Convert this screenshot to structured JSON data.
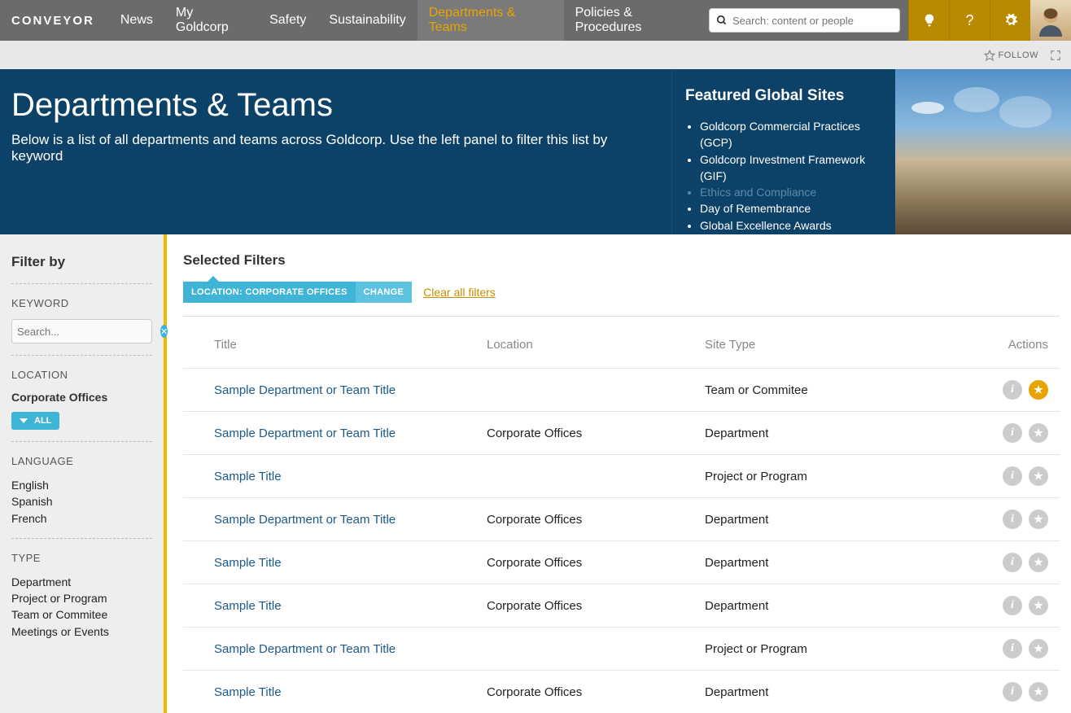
{
  "brand": "CONVEYOR",
  "nav": [
    {
      "label": "News",
      "active": false
    },
    {
      "label": "My Goldcorp",
      "active": false
    },
    {
      "label": "Safety",
      "active": false
    },
    {
      "label": "Sustainability",
      "active": false
    },
    {
      "label": "Departments & Teams",
      "active": true
    },
    {
      "label": "Policies & Procedures",
      "active": false
    }
  ],
  "search": {
    "placeholder": "Search: content or people"
  },
  "utilbar": {
    "follow": "FOLLOW"
  },
  "hero": {
    "title": "Departments & Teams",
    "subtitle": "Below is a list of all departments and teams across Goldcorp. Use the left panel to filter this list by keyword"
  },
  "featured": {
    "heading": "Featured Global Sites",
    "items": [
      {
        "label": "Goldcorp Commercial Practices (GCP)",
        "dimmed": false
      },
      {
        "label": "Goldcorp Investment Framework (GIF)",
        "dimmed": false
      },
      {
        "label": "Ethics and Compliance",
        "dimmed": true
      },
      {
        "label": "Day of Remembrance",
        "dimmed": false
      },
      {
        "label": "Global Excellence Awards",
        "dimmed": false
      }
    ]
  },
  "sidebar": {
    "heading": "Filter by",
    "keyword": {
      "label": "KEYWORD",
      "placeholder": "Search..."
    },
    "location": {
      "label": "LOCATION",
      "value": "Corporate Offices",
      "all_btn": "ALL"
    },
    "language": {
      "label": "LANGUAGE",
      "options": [
        "English",
        "Spanish",
        "French"
      ]
    },
    "type": {
      "label": "TYPE",
      "options": [
        "Department",
        "Project or Program",
        "Team or Commitee",
        "Meetings or Events"
      ]
    }
  },
  "selected_filters": {
    "heading": "Selected Filters",
    "chip_main": "LOCATION: CORPORATE OFFICES",
    "chip_change": "CHANGE",
    "clear_all": "Clear all filters"
  },
  "table": {
    "headers": {
      "title": "Title",
      "location": "Location",
      "type": "Site Type",
      "actions": "Actions"
    },
    "rows": [
      {
        "title": "Sample Department or Team Title",
        "location": "",
        "type": "Team or Commitee",
        "starred": true
      },
      {
        "title": "Sample Department or Team Title",
        "location": "Corporate Offices",
        "type": "Department",
        "starred": false
      },
      {
        "title": "Sample Title",
        "location": "",
        "type": "Project or Program",
        "starred": false
      },
      {
        "title": "Sample Department or Team Title",
        "location": "Corporate Offices",
        "type": "Department",
        "starred": false
      },
      {
        "title": "Sample Title",
        "location": "Corporate Offices",
        "type": "Department",
        "starred": false
      },
      {
        "title": "Sample Title",
        "location": "Corporate Offices",
        "type": "Department",
        "starred": false
      },
      {
        "title": "Sample Department or Team Title",
        "location": "",
        "type": "Project or Program",
        "starred": false
      },
      {
        "title": "Sample Title",
        "location": "Corporate Offices",
        "type": "Department",
        "starred": false
      }
    ]
  }
}
